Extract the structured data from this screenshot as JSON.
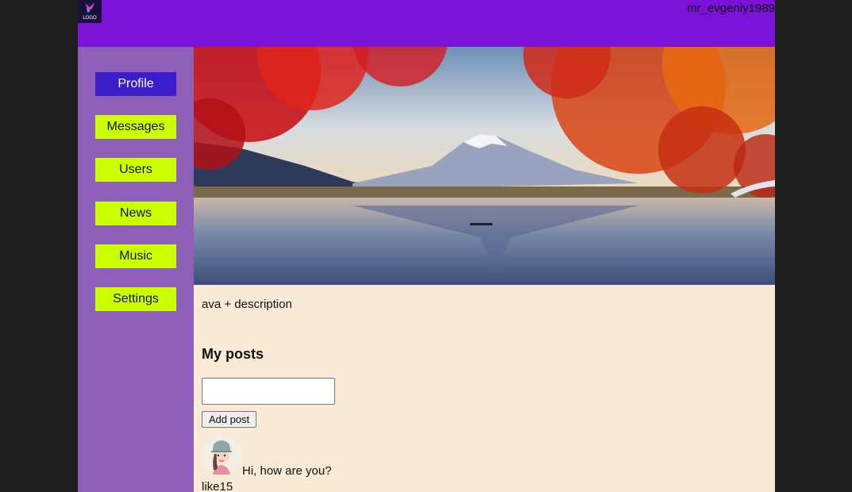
{
  "header": {
    "username": "mr_evgeniy1989",
    "logo_icon": "logo-icon",
    "logo_text": "LOGO"
  },
  "sidebar": {
    "items": [
      {
        "label": "Profile",
        "active": true
      },
      {
        "label": "Messages",
        "active": false
      },
      {
        "label": "Users",
        "active": false
      },
      {
        "label": "News",
        "active": false
      },
      {
        "label": "Music",
        "active": false
      },
      {
        "label": "Settings",
        "active": false
      }
    ]
  },
  "profile": {
    "banner_icon": "mount-fuji-autumn-lake-image",
    "description": "ava + description"
  },
  "posts": {
    "title": "My posts",
    "input_value": "",
    "add_button_label": "Add post",
    "items": [
      {
        "message": "Hi, how are you?",
        "likes": "like15",
        "avatar_icon": "girl-avatar-icon"
      }
    ]
  },
  "colors": {
    "header_bg": "#7a12d8",
    "sidebar_bg": "#8e5fb8",
    "nav_bg": "#ccff00",
    "nav_active_bg": "#3a1cc8",
    "content_bg": "#faebd7",
    "page_bg": "#1e1e1e"
  }
}
